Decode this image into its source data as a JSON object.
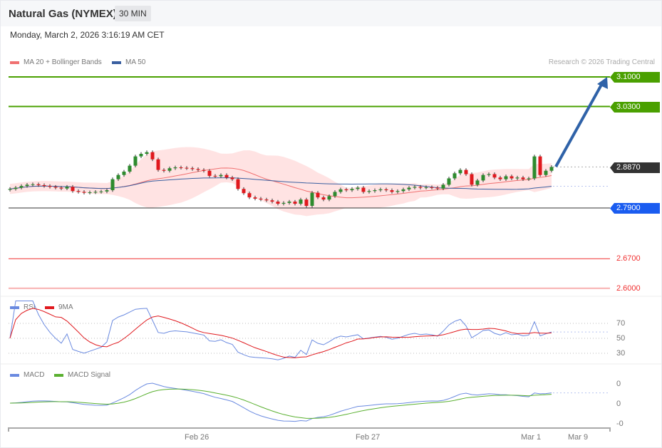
{
  "header": {
    "title": "Natural Gas (NYMEX)",
    "timeframe": "30 MIN",
    "datetime": "Monday, March 2, 2026 3:16:19 AM CET"
  },
  "legend": {
    "ma20": "MA 20 + Bollinger Bands",
    "ma50": "MA 50",
    "credit": "Research © 2026 Trading Central",
    "rsi": "RSI",
    "rsi_ma": "9MA",
    "macd": "MACD",
    "macd_signal": "MACD Signal"
  },
  "colors": {
    "up": "#2e8b2e",
    "down": "#e0191e",
    "ma20": "#f07070",
    "ma50": "#3a5fa0",
    "band": "#ffe3e3",
    "resist": "#4aa000",
    "current": "#333333",
    "support_blue": "#1a5cf0",
    "support_red": "#f03030",
    "rsi": "#6a8ae0",
    "macd_signal": "#5ab030"
  },
  "levels": [
    {
      "label": "3.1000",
      "value": 3.1,
      "type": "resist"
    },
    {
      "label": "3.0300",
      "value": 3.03,
      "type": "resist"
    },
    {
      "label": "2.8870",
      "value": 2.887,
      "type": "current"
    },
    {
      "label": "2.7900",
      "value": 2.79,
      "type": "pivot"
    },
    {
      "label": "2.6700",
      "value": 2.67,
      "type": "support"
    },
    {
      "label": "2.6000",
      "value": 2.6,
      "type": "support"
    }
  ],
  "rsi_axis": [
    "70",
    "50",
    "30"
  ],
  "macd_axis": [
    "0",
    "0",
    "-0"
  ],
  "x_axis": [
    "Feb 26",
    "Feb 27",
    "Mar 1",
    "Mar 9"
  ],
  "chart_data": {
    "type": "candlestick",
    "closes": [
      2.835,
      2.838,
      2.842,
      2.845,
      2.846,
      2.844,
      2.842,
      2.84,
      2.838,
      2.836,
      2.84,
      2.83,
      2.828,
      2.826,
      2.827,
      2.828,
      2.829,
      2.832,
      2.858,
      2.868,
      2.876,
      2.89,
      2.912,
      2.918,
      2.922,
      2.905,
      2.88,
      2.878,
      2.884,
      2.886,
      2.885,
      2.884,
      2.882,
      2.88,
      2.878,
      2.866,
      2.865,
      2.868,
      2.862,
      2.858,
      2.835,
      2.825,
      2.815,
      2.812,
      2.81,
      2.808,
      2.805,
      2.8,
      2.802,
      2.805,
      2.8,
      2.81,
      2.795,
      2.826,
      2.815,
      2.81,
      2.818,
      2.828,
      2.834,
      2.832,
      2.835,
      2.838,
      2.828,
      2.83,
      2.832,
      2.834,
      2.832,
      2.828,
      2.83,
      2.834,
      2.838,
      2.84,
      2.838,
      2.839,
      2.838,
      2.836,
      2.845,
      2.86,
      2.872,
      2.88,
      2.87,
      2.845,
      2.855,
      2.868,
      2.87,
      2.862,
      2.858,
      2.865,
      2.86,
      2.862,
      2.858,
      2.86,
      2.912,
      2.868,
      2.878,
      2.887
    ],
    "target": 3.1
  }
}
